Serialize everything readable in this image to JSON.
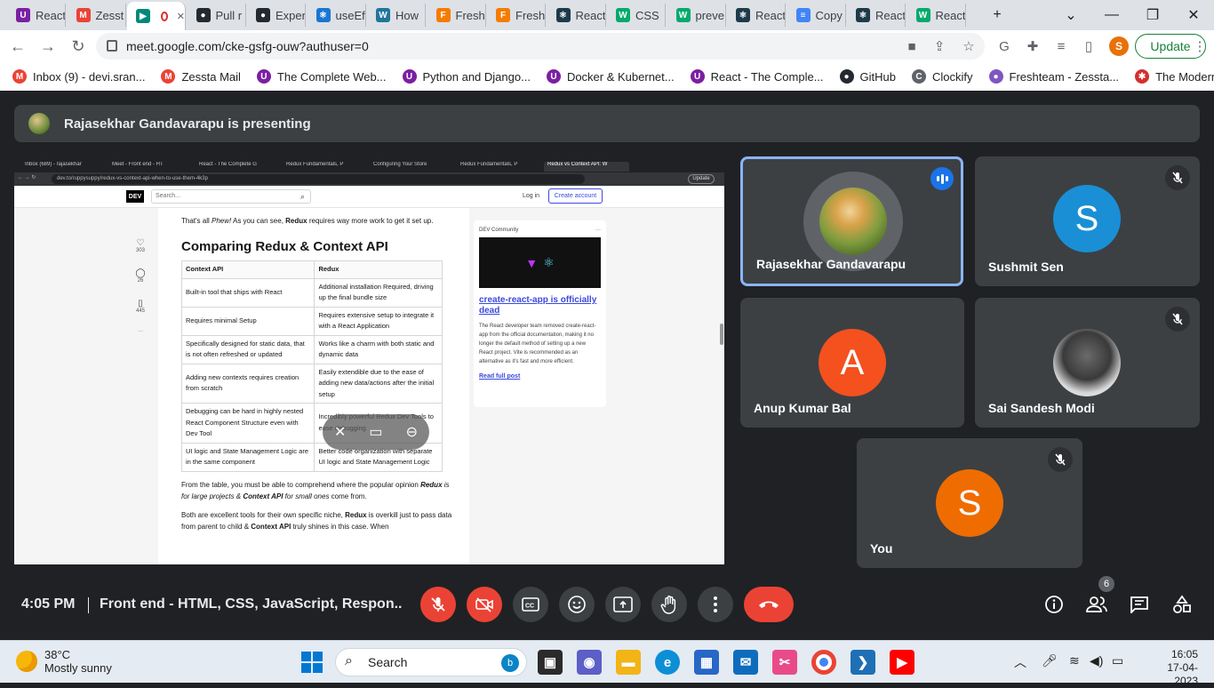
{
  "browser": {
    "tabs": [
      {
        "title": "React",
        "favicon_color": "#7b1fa2",
        "favicon_glyph": "U"
      },
      {
        "title": "Zesst",
        "favicon_color": "#ea4335",
        "favicon_glyph": "M"
      },
      {
        "title": "",
        "favicon_color": "#00897b",
        "favicon_glyph": "▶",
        "active": true
      },
      {
        "title": "Pull r",
        "favicon_color": "#24292f",
        "favicon_glyph": "●"
      },
      {
        "title": "Exper",
        "favicon_color": "#24292f",
        "favicon_glyph": "●"
      },
      {
        "title": "useEf",
        "favicon_color": "#1976d2",
        "favicon_glyph": "⚛"
      },
      {
        "title": "How",
        "favicon_color": "#21759b",
        "favicon_glyph": "W"
      },
      {
        "title": "Fresh",
        "favicon_color": "#f57c00",
        "favicon_glyph": "F"
      },
      {
        "title": "Fresh",
        "favicon_color": "#f57c00",
        "favicon_glyph": "F"
      },
      {
        "title": "React",
        "favicon_color": "#1e3a4a",
        "favicon_glyph": "⚛"
      },
      {
        "title": "CSS",
        "favicon_color": "#04aa6d",
        "favicon_glyph": "W"
      },
      {
        "title": "preve",
        "favicon_color": "#04aa6d",
        "favicon_glyph": "W"
      },
      {
        "title": "React",
        "favicon_color": "#1e3a4a",
        "favicon_glyph": "⚛"
      },
      {
        "title": "Copy",
        "favicon_color": "#4285f4",
        "favicon_glyph": "≡"
      },
      {
        "title": "React",
        "favicon_color": "#1e3a4a",
        "favicon_glyph": "⚛"
      },
      {
        "title": "React",
        "favicon_color": "#04aa6d",
        "favicon_glyph": "W"
      }
    ],
    "url": "meet.google.com/cke-gsfg-ouw?authuser=0",
    "update_label": "Update",
    "profile_initial": "S",
    "bookmarks": [
      {
        "label": "Inbox (9) - devi.sran...",
        "icon": "gmail-icon",
        "color": "#ea4335",
        "glyph": "M"
      },
      {
        "label": "Zessta Mail",
        "icon": "gmail-icon",
        "color": "#ea4335",
        "glyph": "M"
      },
      {
        "label": "The Complete Web...",
        "icon": "udemy-icon",
        "color": "#7b1fa2",
        "glyph": "U"
      },
      {
        "label": "Python and Django...",
        "icon": "udemy-icon",
        "color": "#7b1fa2",
        "glyph": "U"
      },
      {
        "label": "Docker & Kubernet...",
        "icon": "udemy-icon",
        "color": "#7b1fa2",
        "glyph": "U"
      },
      {
        "label": "React - The Comple...",
        "icon": "udemy-icon",
        "color": "#7b1fa2",
        "glyph": "U"
      },
      {
        "label": "GitHub",
        "icon": "github-icon",
        "color": "#24292f",
        "glyph": "●"
      },
      {
        "label": "Clockify",
        "icon": "clockify-icon",
        "color": "#5f6368",
        "glyph": "C"
      },
      {
        "label": "Freshteam - Zessta...",
        "icon": "freshteam-icon",
        "color": "#7e57c2",
        "glyph": "●"
      },
      {
        "label": "The Modern JavaSc...",
        "icon": "js-info-icon",
        "color": "#d32f2f",
        "glyph": "✱"
      }
    ]
  },
  "meet": {
    "presenting_text": "Rajasekhar Gandavarapu is presenting",
    "participants": [
      {
        "name": "Rajasekhar Gandavarapu",
        "initial": "",
        "avatar_color": "#6b8c3a",
        "speaking": true,
        "muted": false
      },
      {
        "name": "Sushmit Sen",
        "initial": "S",
        "avatar_color": "#1a8fd6",
        "speaking": false,
        "muted": true
      },
      {
        "name": "Anup Kumar Bal",
        "initial": "A",
        "avatar_color": "#f4511e",
        "speaking": false,
        "muted": false
      },
      {
        "name": "Sai Sandesh Modi",
        "initial": "",
        "avatar_color": "#777777",
        "speaking": false,
        "muted": true
      },
      {
        "name": "You",
        "initial": "S",
        "avatar_color": "#ef6c00",
        "speaking": false,
        "muted": true
      }
    ],
    "time": "4:05 PM",
    "meeting_title": "Front end - HTML, CSS, JavaScript, Respon...",
    "people_count": "6"
  },
  "shared_screen": {
    "tabs": [
      "Inbox (689) - rajasekhar",
      "Meet - Front end - HT",
      "React - The Complete G",
      "Redux Fundamentals, P",
      "Configuring Your Store",
      "Redux Fundamentals, P",
      "Redux vs Context API: W"
    ],
    "url": "dev.to/ruppysuppy/redux-vs-context-api-when-to-use-them-4k3p",
    "update_label": "Update",
    "dev_logo": "DEV",
    "search_placeholder": "Search...",
    "login_label": "Log in",
    "create_account_label": "Create account",
    "reactions": [
      {
        "icon": "heart-icon",
        "count": "303"
      },
      {
        "icon": "comment-icon",
        "count": "26"
      },
      {
        "icon": "bookmark-icon",
        "count": "445"
      }
    ],
    "intro_pre": "That's all ",
    "intro_phew": "Phew!",
    "intro_mid": " As you can see, ",
    "intro_redux": "Redux",
    "intro_post": " requires way more work to get it set up.",
    "heading": "Comparing Redux & Context API",
    "table": {
      "headers": [
        "Context API",
        "Redux"
      ],
      "rows": [
        [
          "Built-in tool that ships with React",
          "Additional installation Required, driving up the final bundle size"
        ],
        [
          "Requires minimal Setup",
          "Requires extensive setup to integrate it with a React Application"
        ],
        [
          "Specifically designed for static data, that is not often refreshed or updated",
          "Works like a charm with both static and dynamic data"
        ],
        [
          "Adding new contexts requires creation from scratch",
          "Easily extendible due to the ease of adding new data/actions after the initial setup"
        ],
        [
          "Debugging can be hard in highly nested React Component Structure even with Dev Tool",
          "Incredibly powerful Redux Dev Tools to ease debugging"
        ],
        [
          "UI logic and State Management Logic are in the same component",
          "Better code organization with separate UI logic and State Management Logic"
        ]
      ]
    },
    "p1_a": "From the table, you must be able to comprehend where the popular opinion ",
    "p1_b": "Redux",
    "p1_c": " is for large projects & ",
    "p1_d": "Context API",
    "p1_e": " for small ones",
    "p1_f": " come from.",
    "p2_a": "Both are excellent tools for their own specific niche, ",
    "p2_b": "Redux",
    "p2_c": " is overkill just to pass data from parent to child & ",
    "p2_d": "Context API",
    "p2_e": " truly shines in this case. When",
    "card": {
      "community": "DEV Community",
      "menu": "···",
      "title": "create-react-app is officially dead",
      "description": "The React developer team removed create-react-app from the official documentation, making it no longer the default method of setting up a new React project. Vite is recommended as an alternative as it's fast and more efficient.",
      "link": "Read full post"
    }
  },
  "taskbar": {
    "temperature": "38°C",
    "weather": "Mostly sunny",
    "search_label": "Search",
    "time": "16:05",
    "date": "17-04-2023"
  }
}
